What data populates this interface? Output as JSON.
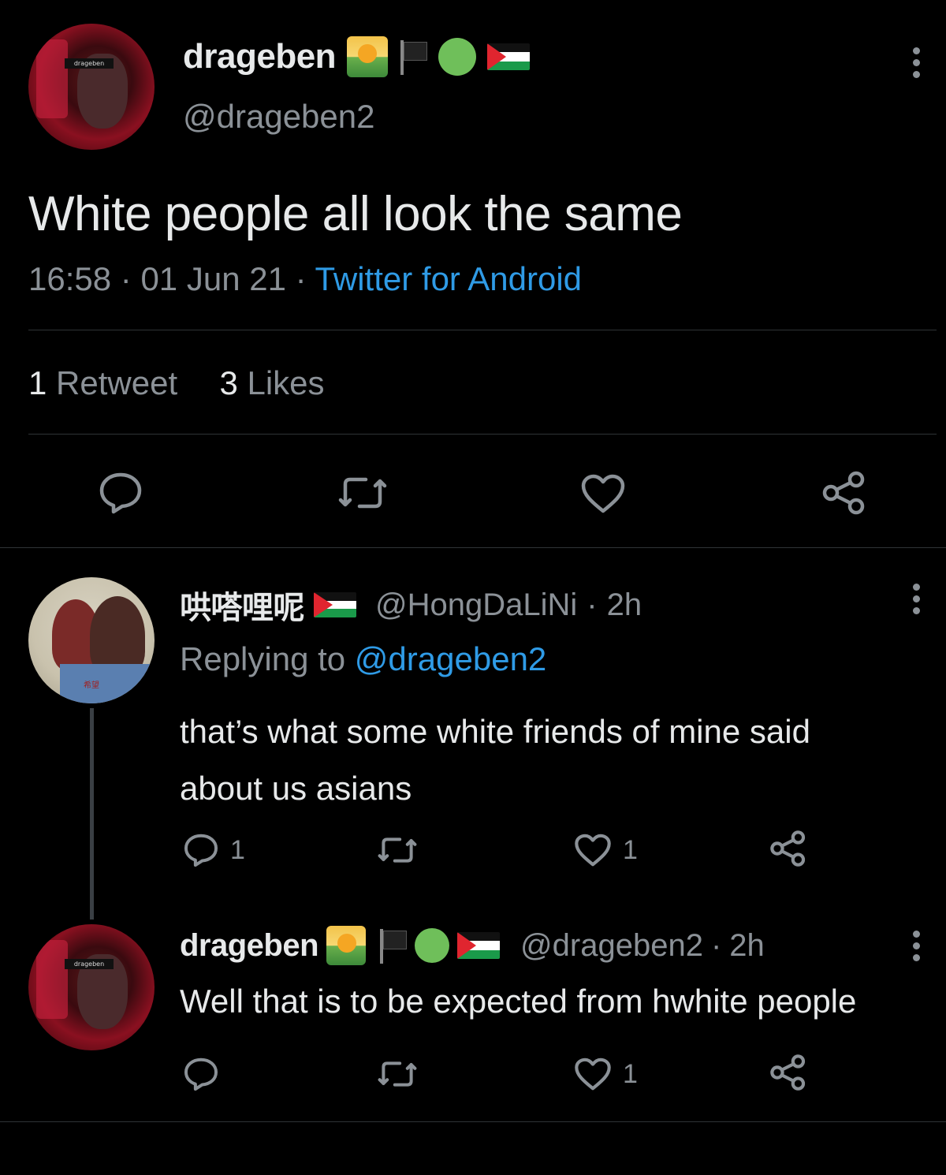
{
  "main_tweet": {
    "display_name": "drageben",
    "handle": "@drageben2",
    "avatar_caption": "drageben",
    "text": "White people all look the same",
    "time": "16:58",
    "date": "01 Jun 21",
    "source": "Twitter for Android",
    "retweet_count": "1",
    "retweet_label": "Retweet",
    "like_count": "3",
    "like_label": "Likes"
  },
  "reply1": {
    "display_name": "哄嗒哩呢",
    "handle": "@HongDaLiNi",
    "age": "2h",
    "replying_prefix": "Replying to",
    "replying_to": "@drageben2",
    "text_line1": "that’s what some white friends of mine said",
    "text_line2": "about us asians",
    "avatar_caption": "希望",
    "reply_count": "1",
    "like_count": "1"
  },
  "reply2": {
    "display_name": "drageben",
    "handle": "@drageben2",
    "age": "2h",
    "avatar_caption": "drageben",
    "text": "Well that is to be expected from hwhite people",
    "like_count": "1"
  },
  "separator": "·",
  "icons": [
    "sunrise-over-mountains-icon",
    "black-flag-icon",
    "green-circle-icon",
    "palestine-flag-icon",
    "reply-icon",
    "retweet-icon",
    "like-icon",
    "share-icon",
    "more-icon"
  ],
  "colors": {
    "background": "#000000",
    "text": "#e7e9ea",
    "muted": "#8b9197",
    "link": "#2f9be6"
  }
}
